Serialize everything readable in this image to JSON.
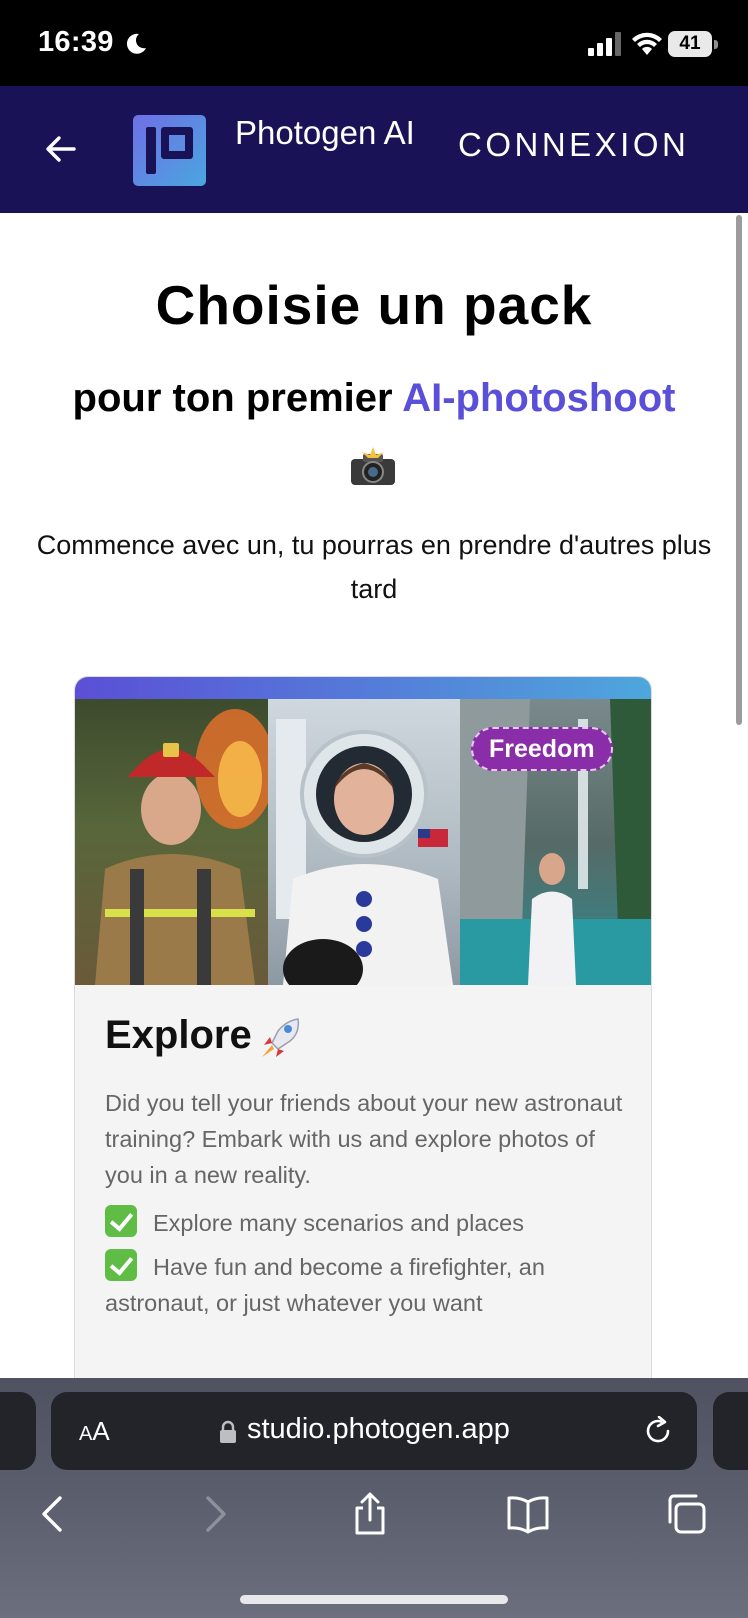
{
  "status_bar": {
    "time": "16:39",
    "battery": "41"
  },
  "header": {
    "brand_name": "Photogen AI",
    "login_label": "CONNEXION"
  },
  "main": {
    "title": "Choisie un pack",
    "subtitle_prefix": "pour ton premier ",
    "subtitle_accent": "AI-photoshoot",
    "intro": "Commence avec un, tu pourras en prendre d'autres plus tard"
  },
  "pack": {
    "badge": "Freedom",
    "name": "Explore",
    "description": "Did you tell your friends about your new astronaut training? Embark with us and explore photos of you in a new reality.",
    "features": [
      "Explore many scenarios and places",
      "Have fun and become a firefighter, an astronaut, or just whatever you want"
    ],
    "photos": [
      "firefighter",
      "astronaut",
      "waterfall"
    ]
  },
  "browser": {
    "aa_label_small": "A",
    "aa_label_large": "A",
    "url": "studio.photogen.app"
  },
  "colors": {
    "header_bg": "#1a1256",
    "accent": "#5a4fd8",
    "badge_bg": "#8a2da8",
    "check_green": "#5fbd45"
  }
}
